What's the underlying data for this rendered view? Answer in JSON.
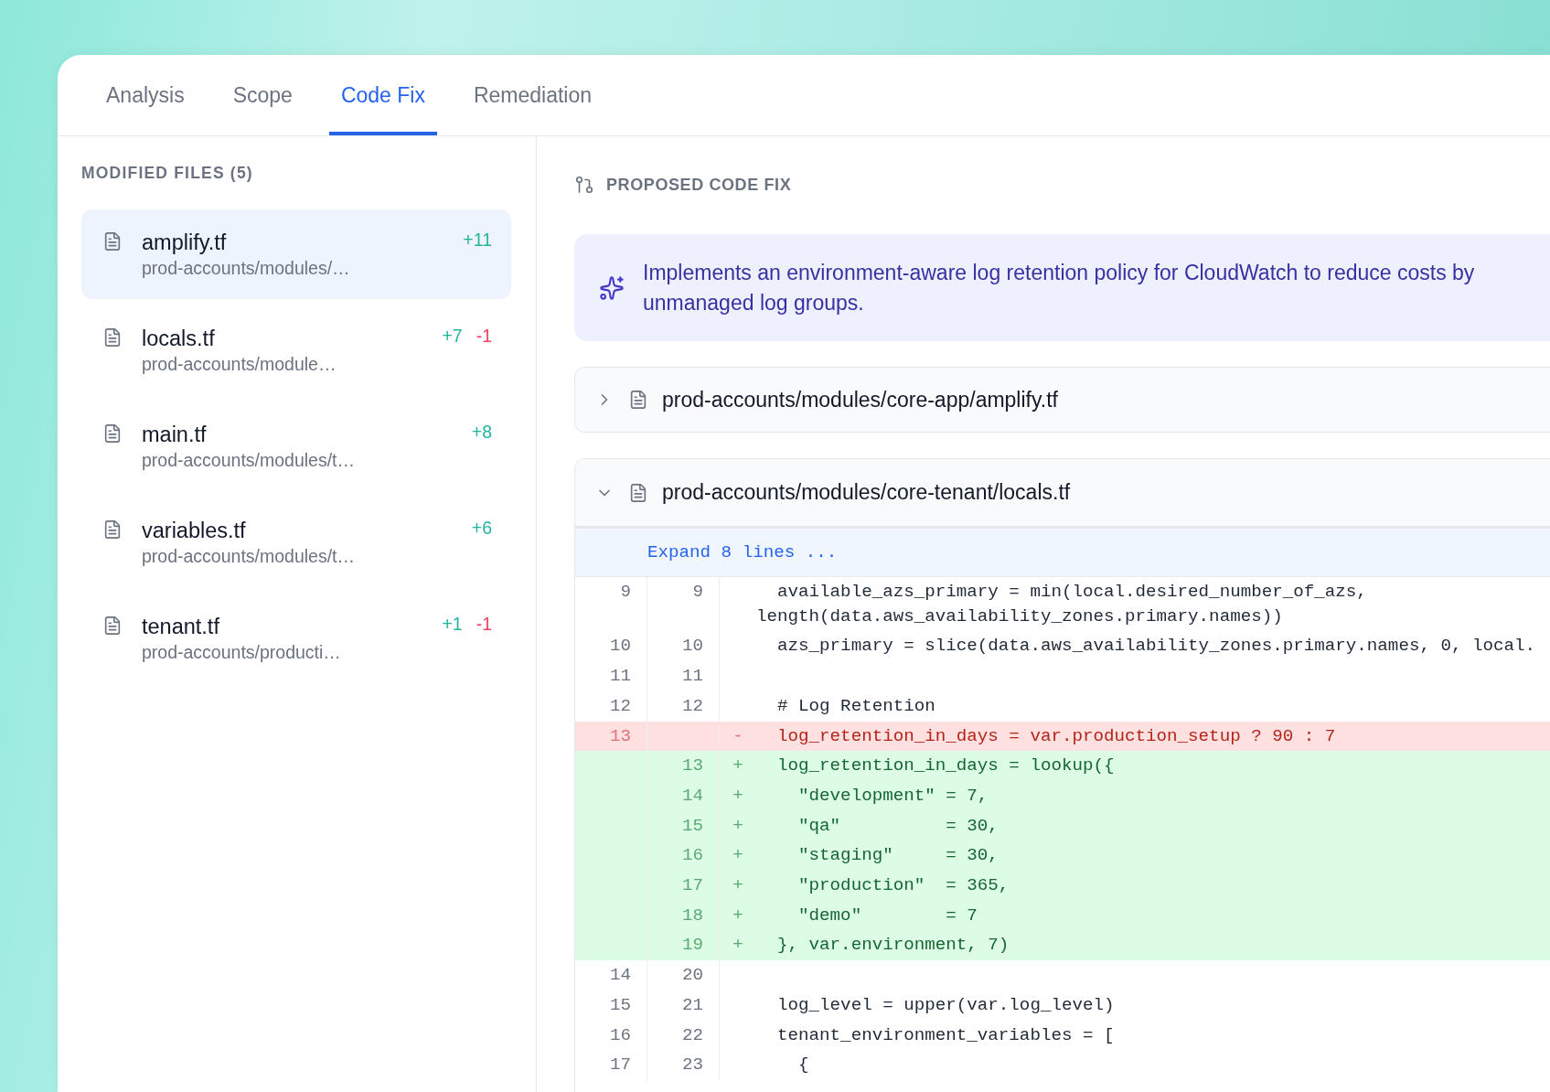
{
  "tabs": [
    {
      "label": "Analysis",
      "selected": false
    },
    {
      "label": "Scope",
      "selected": false
    },
    {
      "label": "Code Fix",
      "selected": true
    },
    {
      "label": "Remediation",
      "selected": false
    }
  ],
  "files_panel": {
    "title": "MODIFIED FILES (5)",
    "files": [
      {
        "name": "amplify.tf",
        "path": "prod-accounts/modules/…",
        "added": "+11",
        "selected": true
      },
      {
        "name": "locals.tf",
        "path": "prod-accounts/module…",
        "added": "+7",
        "removed": "-1",
        "selected": false
      },
      {
        "name": "main.tf",
        "path": "prod-accounts/modules/t…",
        "added": "+8",
        "selected": false
      },
      {
        "name": "variables.tf",
        "path": "prod-accounts/modules/t…",
        "added": "+6",
        "selected": false
      },
      {
        "name": "tenant.tf",
        "path": "prod-accounts/producti…",
        "added": "+1",
        "removed": "-1",
        "selected": false
      }
    ]
  },
  "fix_panel": {
    "title": "PROPOSED CODE FIX",
    "summary": "Implements an environment-aware log retention policy for CloudWatch to reduce costs by unmanaged log groups.",
    "diffs": [
      {
        "path": "prod-accounts/modules/core-app/amplify.tf",
        "expanded": false
      },
      {
        "path": "prod-accounts/modules/core-tenant/locals.tf",
        "expanded": true,
        "expand_label": "Expand 8 lines ...",
        "lines": [
          {
            "kind": "context",
            "old": "9",
            "new": "9",
            "code": "  available_azs_primary = min(local.desired_number_of_azs, length(data.aws_availability_zones.primary.names))"
          },
          {
            "kind": "context",
            "old": "10",
            "new": "10",
            "code": "  azs_primary = slice(data.aws_availability_zones.primary.names, 0, local."
          },
          {
            "kind": "context",
            "old": "11",
            "new": "11"
          },
          {
            "kind": "context",
            "old": "12",
            "new": "12",
            "code": "  # Log Retention"
          },
          {
            "kind": "removed",
            "old": "13",
            "sign": "-",
            "code": "  log_retention_in_days = var.production_setup ? 90 : 7"
          },
          {
            "kind": "added",
            "new": "13",
            "sign": "+",
            "code": "  log_retention_in_days = lookup({"
          },
          {
            "kind": "added",
            "new": "14",
            "sign": "+",
            "code": "    \"development\" = 7,"
          },
          {
            "kind": "added",
            "new": "15",
            "sign": "+",
            "code": "    \"qa\"          = 30,"
          },
          {
            "kind": "added",
            "new": "16",
            "sign": "+",
            "code": "    \"staging\"     = 30,"
          },
          {
            "kind": "added",
            "new": "17",
            "sign": "+",
            "code": "    \"production\"  = 365,"
          },
          {
            "kind": "added",
            "new": "18",
            "sign": "+",
            "code": "    \"demo\"        = 7"
          },
          {
            "kind": "added",
            "new": "19",
            "sign": "+",
            "code": "  }, var.environment, 7)"
          },
          {
            "kind": "context",
            "old": "14",
            "new": "20"
          },
          {
            "kind": "context",
            "old": "15",
            "new": "21",
            "code": "  log_level = upper(var.log_level)"
          },
          {
            "kind": "context",
            "old": "16",
            "new": "22",
            "code": "  tenant_environment_variables = ["
          },
          {
            "kind": "context",
            "old": "17",
            "new": "23",
            "code": "    {"
          }
        ]
      }
    ]
  }
}
